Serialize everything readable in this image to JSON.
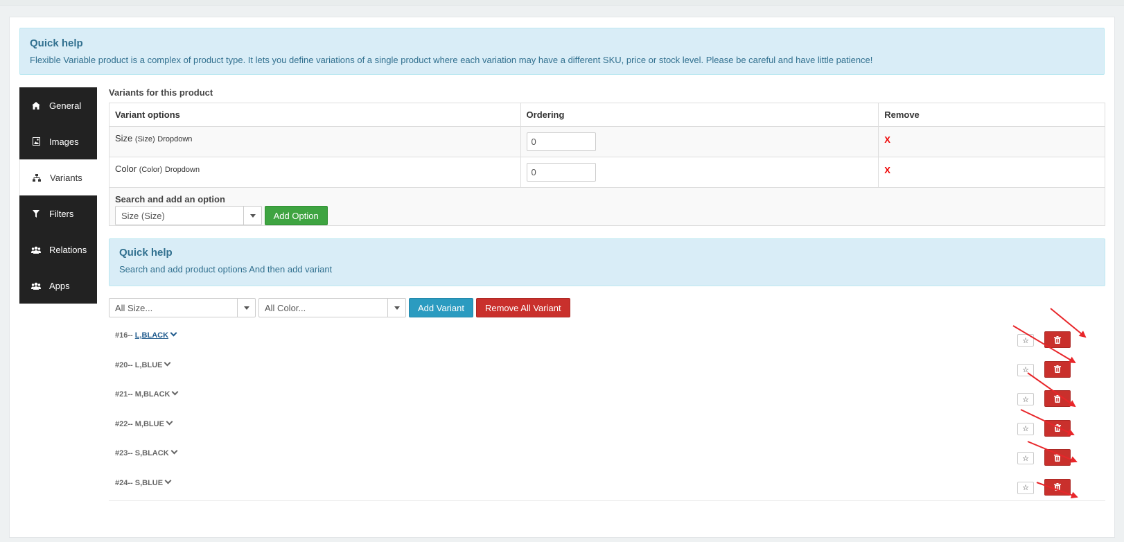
{
  "quick_help_top": {
    "title": "Quick help",
    "text": "Flexible Variable product is a complex of product type. It lets you define variations of a single product where each variation may have a different SKU, price or stock level. Please be careful and have little patience!"
  },
  "sidebar": {
    "items": [
      {
        "label": "General",
        "icon": "home-icon"
      },
      {
        "label": "Images",
        "icon": "image-icon"
      },
      {
        "label": "Variants",
        "icon": "sitemap-icon",
        "active": true
      },
      {
        "label": "Filters",
        "icon": "filter-icon"
      },
      {
        "label": "Relations",
        "icon": "users-icon"
      },
      {
        "label": "Apps",
        "icon": "users-icon"
      }
    ]
  },
  "variants_section": {
    "title": "Variants for this product",
    "columns": [
      "Variant options",
      "Ordering",
      "Remove"
    ],
    "rows": [
      {
        "name": "Size",
        "code": "(Size)",
        "type": "Dropdown",
        "ordering": "0",
        "remove": "X"
      },
      {
        "name": "Color",
        "code": "(Color)",
        "type": "Dropdown",
        "ordering": "0",
        "remove": "X"
      }
    ],
    "search_label": "Search and add an option",
    "search_selected": "Size (Size)",
    "add_option_label": "Add Option"
  },
  "quick_help_mid": {
    "title": "Quick help",
    "text": "Search and add product options And then add variant"
  },
  "filters": {
    "size_selected": "All Size...",
    "color_selected": "All Color...",
    "add_variant_label": "Add Variant",
    "remove_all_label": "Remove All Variant"
  },
  "variant_list": [
    {
      "id": "#16--",
      "name": "L,BLACK"
    },
    {
      "id": "#20--",
      "name": "L,BLUE"
    },
    {
      "id": "#21--",
      "name": "M,BLACK"
    },
    {
      "id": "#22--",
      "name": "M,BLUE"
    },
    {
      "id": "#23--",
      "name": "S,BLACK"
    },
    {
      "id": "#24--",
      "name": "S,BLUE"
    }
  ],
  "colors": {
    "sidebar_bg": "#222222",
    "info_bg": "#d9edf7",
    "info_text": "#31708f",
    "danger": "#c9302c",
    "success": "#3ea441",
    "primary": "#2b9bc0",
    "annotation_arrow": "#e8262a"
  }
}
